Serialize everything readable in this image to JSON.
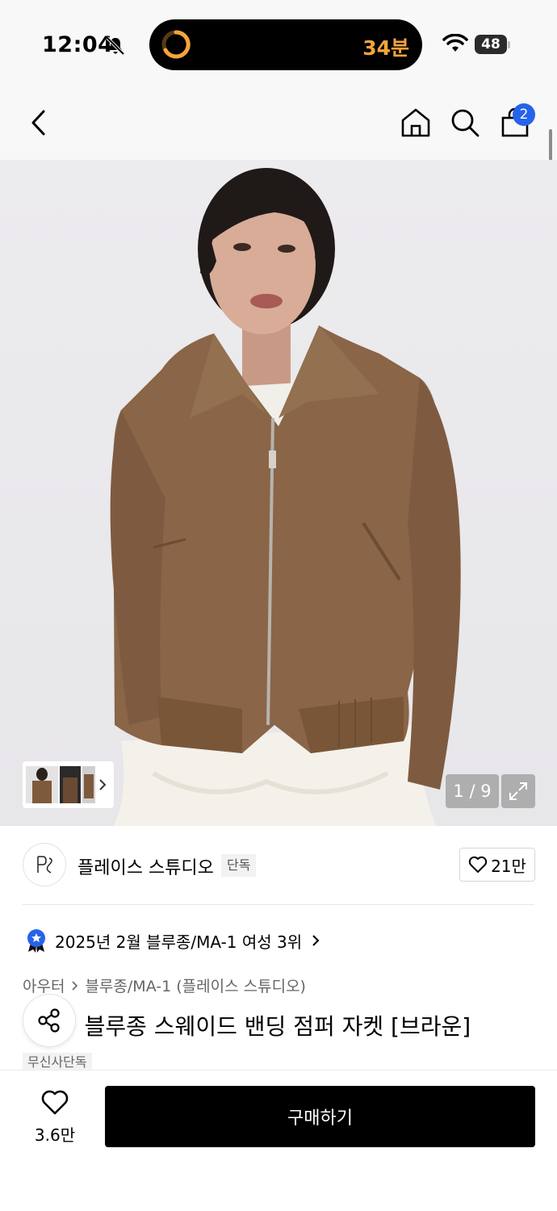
{
  "status_bar": {
    "time": "12:04",
    "timer": "34분",
    "battery": "48"
  },
  "nav": {
    "cart_count": "2"
  },
  "gallery": {
    "pager": "1 / 9"
  },
  "brand": {
    "name": "플레이스 스튜디오",
    "badge": "단독",
    "likes": "21만"
  },
  "ranking": {
    "text": "2025년 2월 블루종/MA-1 여성 3위"
  },
  "breadcrumb": {
    "category": "아우터",
    "subcategory": "블루종/MA-1 (플레이스 스튜디오)"
  },
  "product": {
    "title": "ㅣ 블루종 스웨이드 밴딩 점퍼 자켓 [브라운]",
    "tag": "무신사단독"
  },
  "bottom_bar": {
    "fav_count": "3.6만",
    "buy_label": "구매하기"
  },
  "colors": {
    "accent_blue": "#2563eb",
    "timer_orange": "#f4a53b",
    "jacket_brown": "#8a6548"
  }
}
